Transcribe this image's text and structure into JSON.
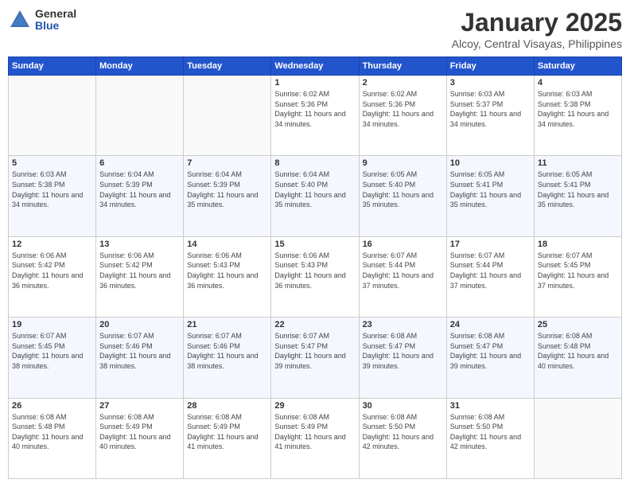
{
  "header": {
    "logo_general": "General",
    "logo_blue": "Blue",
    "month_title": "January 2025",
    "location": "Alcoy, Central Visayas, Philippines"
  },
  "weekdays": [
    "Sunday",
    "Monday",
    "Tuesday",
    "Wednesday",
    "Thursday",
    "Friday",
    "Saturday"
  ],
  "weeks": [
    [
      {
        "day": "",
        "sunrise": "",
        "sunset": "",
        "daylight": ""
      },
      {
        "day": "",
        "sunrise": "",
        "sunset": "",
        "daylight": ""
      },
      {
        "day": "",
        "sunrise": "",
        "sunset": "",
        "daylight": ""
      },
      {
        "day": "1",
        "sunrise": "Sunrise: 6:02 AM",
        "sunset": "Sunset: 5:36 PM",
        "daylight": "Daylight: 11 hours and 34 minutes."
      },
      {
        "day": "2",
        "sunrise": "Sunrise: 6:02 AM",
        "sunset": "Sunset: 5:36 PM",
        "daylight": "Daylight: 11 hours and 34 minutes."
      },
      {
        "day": "3",
        "sunrise": "Sunrise: 6:03 AM",
        "sunset": "Sunset: 5:37 PM",
        "daylight": "Daylight: 11 hours and 34 minutes."
      },
      {
        "day": "4",
        "sunrise": "Sunrise: 6:03 AM",
        "sunset": "Sunset: 5:38 PM",
        "daylight": "Daylight: 11 hours and 34 minutes."
      }
    ],
    [
      {
        "day": "5",
        "sunrise": "Sunrise: 6:03 AM",
        "sunset": "Sunset: 5:38 PM",
        "daylight": "Daylight: 11 hours and 34 minutes."
      },
      {
        "day": "6",
        "sunrise": "Sunrise: 6:04 AM",
        "sunset": "Sunset: 5:39 PM",
        "daylight": "Daylight: 11 hours and 34 minutes."
      },
      {
        "day": "7",
        "sunrise": "Sunrise: 6:04 AM",
        "sunset": "Sunset: 5:39 PM",
        "daylight": "Daylight: 11 hours and 35 minutes."
      },
      {
        "day": "8",
        "sunrise": "Sunrise: 6:04 AM",
        "sunset": "Sunset: 5:40 PM",
        "daylight": "Daylight: 11 hours and 35 minutes."
      },
      {
        "day": "9",
        "sunrise": "Sunrise: 6:05 AM",
        "sunset": "Sunset: 5:40 PM",
        "daylight": "Daylight: 11 hours and 35 minutes."
      },
      {
        "day": "10",
        "sunrise": "Sunrise: 6:05 AM",
        "sunset": "Sunset: 5:41 PM",
        "daylight": "Daylight: 11 hours and 35 minutes."
      },
      {
        "day": "11",
        "sunrise": "Sunrise: 6:05 AM",
        "sunset": "Sunset: 5:41 PM",
        "daylight": "Daylight: 11 hours and 35 minutes."
      }
    ],
    [
      {
        "day": "12",
        "sunrise": "Sunrise: 6:06 AM",
        "sunset": "Sunset: 5:42 PM",
        "daylight": "Daylight: 11 hours and 36 minutes."
      },
      {
        "day": "13",
        "sunrise": "Sunrise: 6:06 AM",
        "sunset": "Sunset: 5:42 PM",
        "daylight": "Daylight: 11 hours and 36 minutes."
      },
      {
        "day": "14",
        "sunrise": "Sunrise: 6:06 AM",
        "sunset": "Sunset: 5:43 PM",
        "daylight": "Daylight: 11 hours and 36 minutes."
      },
      {
        "day": "15",
        "sunrise": "Sunrise: 6:06 AM",
        "sunset": "Sunset: 5:43 PM",
        "daylight": "Daylight: 11 hours and 36 minutes."
      },
      {
        "day": "16",
        "sunrise": "Sunrise: 6:07 AM",
        "sunset": "Sunset: 5:44 PM",
        "daylight": "Daylight: 11 hours and 37 minutes."
      },
      {
        "day": "17",
        "sunrise": "Sunrise: 6:07 AM",
        "sunset": "Sunset: 5:44 PM",
        "daylight": "Daylight: 11 hours and 37 minutes."
      },
      {
        "day": "18",
        "sunrise": "Sunrise: 6:07 AM",
        "sunset": "Sunset: 5:45 PM",
        "daylight": "Daylight: 11 hours and 37 minutes."
      }
    ],
    [
      {
        "day": "19",
        "sunrise": "Sunrise: 6:07 AM",
        "sunset": "Sunset: 5:45 PM",
        "daylight": "Daylight: 11 hours and 38 minutes."
      },
      {
        "day": "20",
        "sunrise": "Sunrise: 6:07 AM",
        "sunset": "Sunset: 5:46 PM",
        "daylight": "Daylight: 11 hours and 38 minutes."
      },
      {
        "day": "21",
        "sunrise": "Sunrise: 6:07 AM",
        "sunset": "Sunset: 5:46 PM",
        "daylight": "Daylight: 11 hours and 38 minutes."
      },
      {
        "day": "22",
        "sunrise": "Sunrise: 6:07 AM",
        "sunset": "Sunset: 5:47 PM",
        "daylight": "Daylight: 11 hours and 39 minutes."
      },
      {
        "day": "23",
        "sunrise": "Sunrise: 6:08 AM",
        "sunset": "Sunset: 5:47 PM",
        "daylight": "Daylight: 11 hours and 39 minutes."
      },
      {
        "day": "24",
        "sunrise": "Sunrise: 6:08 AM",
        "sunset": "Sunset: 5:47 PM",
        "daylight": "Daylight: 11 hours and 39 minutes."
      },
      {
        "day": "25",
        "sunrise": "Sunrise: 6:08 AM",
        "sunset": "Sunset: 5:48 PM",
        "daylight": "Daylight: 11 hours and 40 minutes."
      }
    ],
    [
      {
        "day": "26",
        "sunrise": "Sunrise: 6:08 AM",
        "sunset": "Sunset: 5:48 PM",
        "daylight": "Daylight: 11 hours and 40 minutes."
      },
      {
        "day": "27",
        "sunrise": "Sunrise: 6:08 AM",
        "sunset": "Sunset: 5:49 PM",
        "daylight": "Daylight: 11 hours and 40 minutes."
      },
      {
        "day": "28",
        "sunrise": "Sunrise: 6:08 AM",
        "sunset": "Sunset: 5:49 PM",
        "daylight": "Daylight: 11 hours and 41 minutes."
      },
      {
        "day": "29",
        "sunrise": "Sunrise: 6:08 AM",
        "sunset": "Sunset: 5:49 PM",
        "daylight": "Daylight: 11 hours and 41 minutes."
      },
      {
        "day": "30",
        "sunrise": "Sunrise: 6:08 AM",
        "sunset": "Sunset: 5:50 PM",
        "daylight": "Daylight: 11 hours and 42 minutes."
      },
      {
        "day": "31",
        "sunrise": "Sunrise: 6:08 AM",
        "sunset": "Sunset: 5:50 PM",
        "daylight": "Daylight: 11 hours and 42 minutes."
      },
      {
        "day": "",
        "sunrise": "",
        "sunset": "",
        "daylight": ""
      }
    ]
  ]
}
